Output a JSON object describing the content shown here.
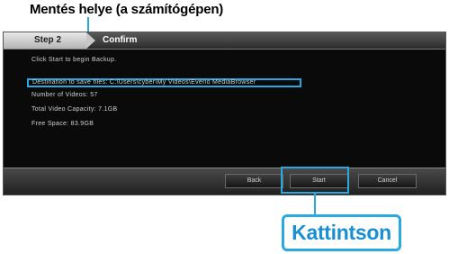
{
  "annotations": {
    "save_location_title": "Mentés helye (a számítógépen)",
    "click_label": "Kattintson"
  },
  "wizard": {
    "step_label": "Step 2",
    "crumb_label": "Confirm",
    "lines": [
      "Click Start to begin Backup.",
      "Destination to save files: C:\\Users\\cyber\\My Videos\\Everio MediaBrowser",
      "Number of Videos: 57",
      "Total Video Capacity: 7.1GB",
      "Free Space: 83.9GB"
    ],
    "buttons": {
      "back": "Back",
      "start": "Start",
      "cancel": "Cancel"
    }
  },
  "colors": {
    "accent": "#29a9e0",
    "window_bg": "#0a0a0a"
  }
}
